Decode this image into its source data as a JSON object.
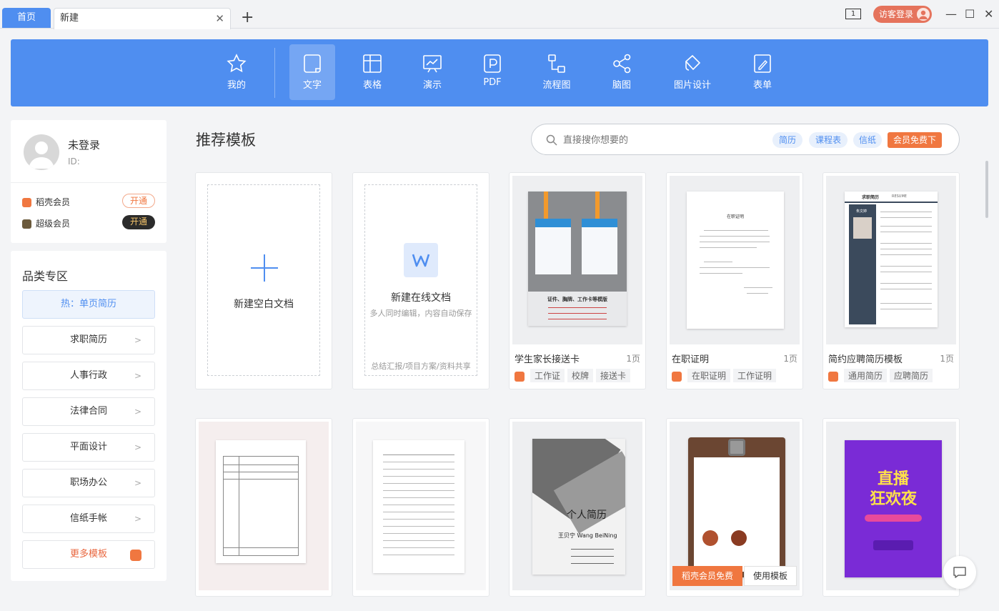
{
  "titlebar": {
    "home_tab": "首页",
    "new_tab": "新建",
    "close_glyph": "✕",
    "add_glyph": "+",
    "pager": "1",
    "login": "访客登录",
    "minimize": "—",
    "maximize": "☐",
    "close": "✕"
  },
  "toolbar": {
    "items": [
      "我的",
      "文字",
      "表格",
      "演示",
      "PDF",
      "流程图",
      "脑图",
      "图片设计",
      "表单"
    ],
    "active": "文字"
  },
  "user": {
    "name": "未登录",
    "id_label": "ID:",
    "vip1": "稻壳会员",
    "vip1_btn": "开通",
    "vip2": "超级会员",
    "vip2_btn": "开通"
  },
  "categories": {
    "title": "品类专区",
    "items": [
      "热：单页简历",
      "求职简历",
      "人事行政",
      "法律合同",
      "平面设计",
      "职场办公",
      "信纸手帐",
      "更多模板"
    ]
  },
  "main": {
    "heading": "推荐模板",
    "search_placeholder": "直接搜你想要的",
    "search_tags": [
      "简历",
      "课程表",
      "信纸"
    ],
    "vip_free_btn": "会员免费下"
  },
  "blank_card": {
    "label": "新建空白文档"
  },
  "online_card": {
    "label": "新建在线文档",
    "sub": "多人同时编辑，内容自动保存",
    "footer": "总结汇报/项目方案/资料共享"
  },
  "cards": [
    {
      "title": "学生家长接送卡",
      "pages": "1页",
      "tags": [
        "工作证",
        "校牌",
        "接送卡"
      ]
    },
    {
      "title": "在职证明",
      "pages": "1页",
      "tags": [
        "在职证明",
        "工作证明"
      ]
    },
    {
      "title": "简约应聘简历模板",
      "pages": "1页",
      "tags": [
        "通用简历",
        "应聘简历"
      ]
    }
  ],
  "thumb_text": {
    "badge_card": "证件、胸牌、工作卡等模版",
    "certificate": "在职证明",
    "resume_title": "求职简历",
    "resume_en": "RESUME",
    "resume_name": "朱文婷",
    "personal_resume": "个人简历",
    "person_name": "王贝宁 Wang BeiNing",
    "live_1": "直播",
    "live_2": "狂欢夜"
  },
  "hover": {
    "vip_free": "稻壳会员免费",
    "use_template": "使用模板"
  },
  "colors": {
    "primary": "#4f8ef0",
    "accent": "#f07740",
    "login": "#e5735c"
  }
}
